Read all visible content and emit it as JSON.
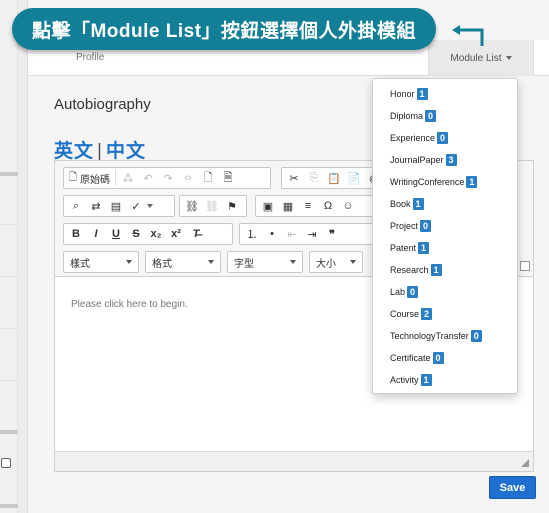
{
  "callout": {
    "text": "點擊「Module List」按鈕選擇個人外掛模組"
  },
  "tabs": {
    "profile": "Profile",
    "module_list": "Module List"
  },
  "autobiography": "Autobiography",
  "lang": {
    "en": "英文",
    "zh": "中文"
  },
  "toolbar": {
    "source": "原始碼",
    "style": "樣式",
    "format": "格式",
    "font": "字型",
    "size": "大小",
    "sub": "x₂",
    "sup": "x²"
  },
  "editor": {
    "placeholder": "Please click here to begin."
  },
  "save_label": "Save",
  "modules": [
    {
      "name": "Honor",
      "count": "1"
    },
    {
      "name": "Diploma",
      "count": "0"
    },
    {
      "name": "Experience",
      "count": "0"
    },
    {
      "name": "JournalPaper",
      "count": "3"
    },
    {
      "name": "WritingConference",
      "count": "1"
    },
    {
      "name": "Book",
      "count": "1"
    },
    {
      "name": "Project",
      "count": "0"
    },
    {
      "name": "Patent",
      "count": "1"
    },
    {
      "name": "Research",
      "count": "1"
    },
    {
      "name": "Lab",
      "count": "0"
    },
    {
      "name": "Course",
      "count": "2"
    },
    {
      "name": "TechnologyTransfer",
      "count": "0"
    },
    {
      "name": "Certificate",
      "count": "0"
    },
    {
      "name": "Activity",
      "count": "1"
    }
  ],
  "colors": {
    "accent": "#137f96",
    "badge": "#2a7ec4",
    "link": "#1e73c8",
    "save": "#1e6fd0"
  }
}
